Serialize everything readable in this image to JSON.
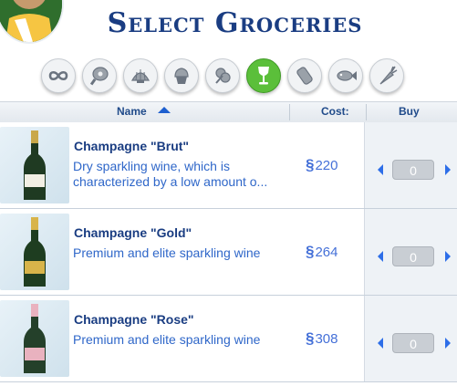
{
  "title": "Select Groceries",
  "filters": [
    {
      "icon": "infinity-icon",
      "active": false
    },
    {
      "icon": "meat-icon",
      "active": false
    },
    {
      "icon": "seafood-icon",
      "active": false
    },
    {
      "icon": "cupcake-icon",
      "active": false
    },
    {
      "icon": "herbs-icon",
      "active": false
    },
    {
      "icon": "wine-glass-icon",
      "active": true
    },
    {
      "icon": "bottle-icon",
      "active": false
    },
    {
      "icon": "fish-icon",
      "active": false
    },
    {
      "icon": "carrot-icon",
      "active": false
    }
  ],
  "columns": {
    "name": "Name",
    "cost": "Cost:",
    "buy": "Buy"
  },
  "currency_symbol": "§",
  "items": [
    {
      "name": "Champagne \"Brut\"",
      "description": "Dry sparkling wine, which is characterized by a low amount o...",
      "cost": "220",
      "quantity": "0",
      "label_color": "#f2efe4"
    },
    {
      "name": "Champagne \"Gold\"",
      "description": "Premium and elite sparkling wine",
      "cost": "264",
      "quantity": "0",
      "label_color": "#d8b44a"
    },
    {
      "name": "Champagne \"Rose\"",
      "description": "Premium and elite sparkling wine",
      "cost": "308",
      "quantity": "0",
      "label_color": "#e9b2bf"
    }
  ]
}
